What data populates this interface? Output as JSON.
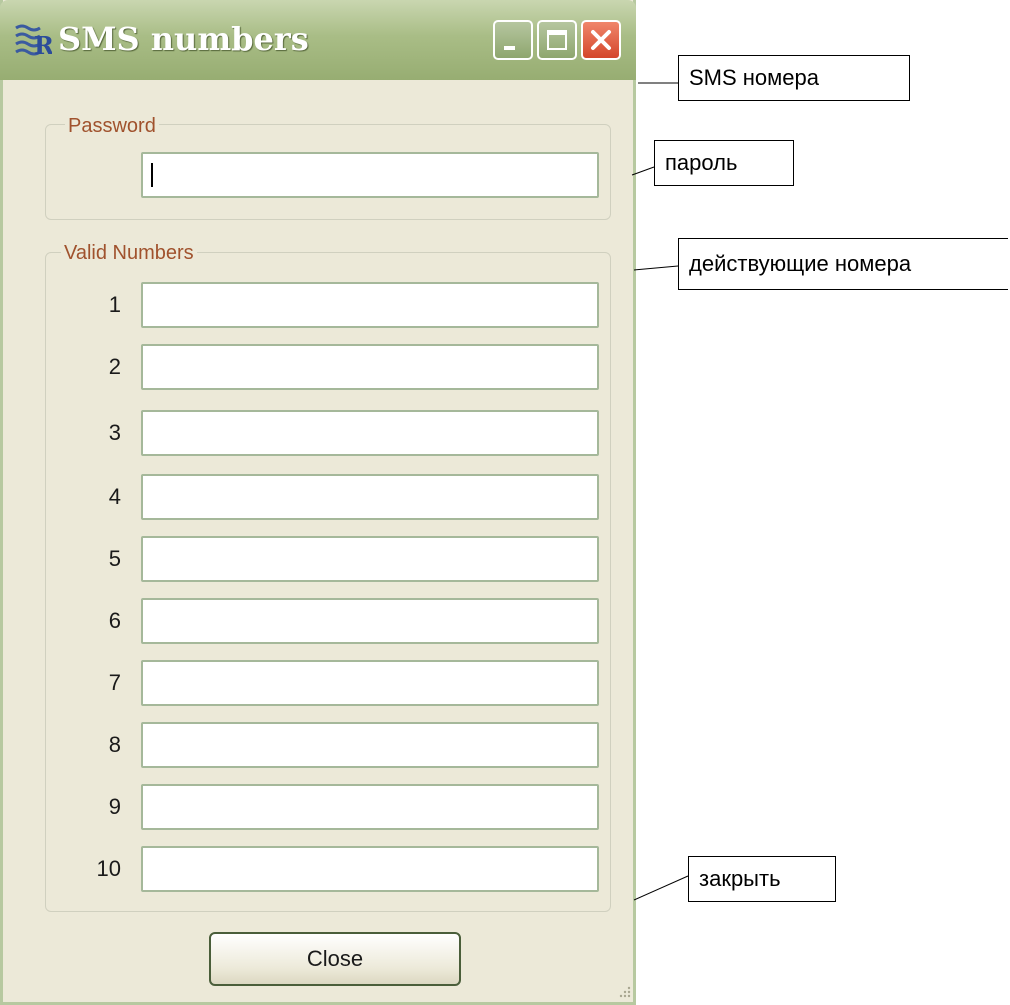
{
  "window": {
    "title": "SMS numbers",
    "minimize_icon": "minimize-icon",
    "maximize_icon": "maximize-icon",
    "close_icon": "close-icon"
  },
  "password_group": {
    "legend": "Password",
    "input_value": ""
  },
  "numbers_group": {
    "legend": "Valid Numbers",
    "rows": [
      {
        "label": "1",
        "value": ""
      },
      {
        "label": "2",
        "value": ""
      },
      {
        "label": "3",
        "value": ""
      },
      {
        "label": "4",
        "value": ""
      },
      {
        "label": "5",
        "value": ""
      },
      {
        "label": "6",
        "value": ""
      },
      {
        "label": "7",
        "value": ""
      },
      {
        "label": "8",
        "value": ""
      },
      {
        "label": "9",
        "value": ""
      },
      {
        "label": "10",
        "value": ""
      }
    ]
  },
  "buttons": {
    "close_label": "Close"
  },
  "annotations": {
    "sms": "SMS номера",
    "password": "пароль",
    "valid_numbers": "действующие номера",
    "close": "закрыть"
  },
  "colors": {
    "titlebar": "#a9bd86",
    "window_bg": "#ece9d8",
    "legend_text": "#a0522d",
    "close_button": "#d4462b"
  }
}
